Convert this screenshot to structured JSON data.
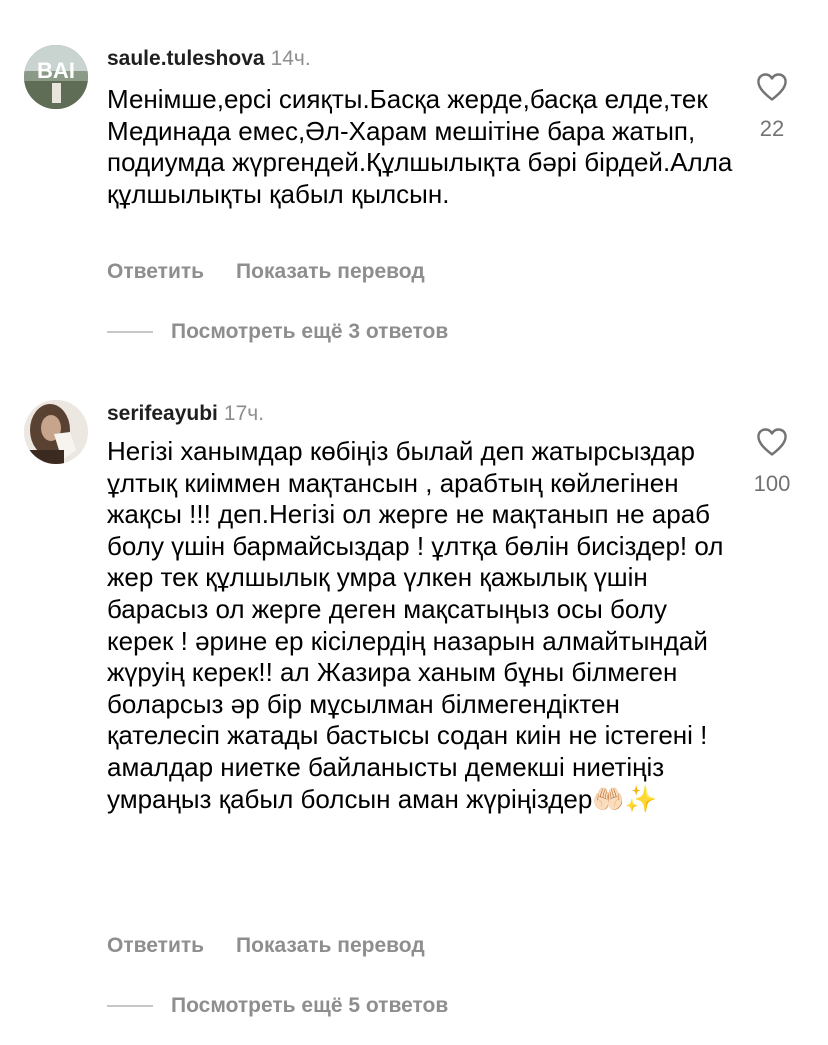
{
  "comments": [
    {
      "username": "saule.tuleshova",
      "time": "14ч.",
      "text": "Менімше,ерсі сияқты.Басқа жерде,басқа елде,тек Мединада емес,Әл-Харам мешітіне бара жатып, подиумда жүргендей.Құлшылықта бәрі бірдей.Алла құлшылықты қабыл қылсын.",
      "likes": "22",
      "reply_label": "Ответить",
      "translate_label": "Показать перевод",
      "view_replies_label": "Посмотреть ещё 3 ответов"
    },
    {
      "username": "serifeayubi",
      "time": "17ч.",
      "text": "Негізі ханымдар көбіңіз былай деп жатырсыздар ұлтық киіммен мақтансын , арабтың көйлегінен жақсы !!! деп.Негізі ол жерге не мақтанып не араб болу үшін бармайсыздар ! ұлтқа бөлін бисіздер! ол жер тек құлшылық умра үлкен қажылық үшін барасыз ол жерге деген мақсатыңыз осы болу керек ! әрине ер кісілердің назарын алмайтындай жүруің керек!! ал Жазира ханым бұны білмеген боларсыз әр бір мұсылман білмегендіктен қателесіп жатады бастысы содан киін не істегені ! амалдар ниетке байланысты демекші ниетіңіз умраңыз қабыл болсын аман жүріңіздер🤲🏻✨",
      "likes": "100",
      "reply_label": "Ответить",
      "translate_label": "Показать перевод",
      "view_replies_label": "Посмотреть ещё 5 ответов"
    }
  ],
  "avatar_1_text": "BAI",
  "icons": {
    "like": "heart-outline-icon"
  },
  "colors": {
    "secondary_text": "#8e8e8e",
    "primary_text": "#000000",
    "divider": "#c7c7c7"
  }
}
